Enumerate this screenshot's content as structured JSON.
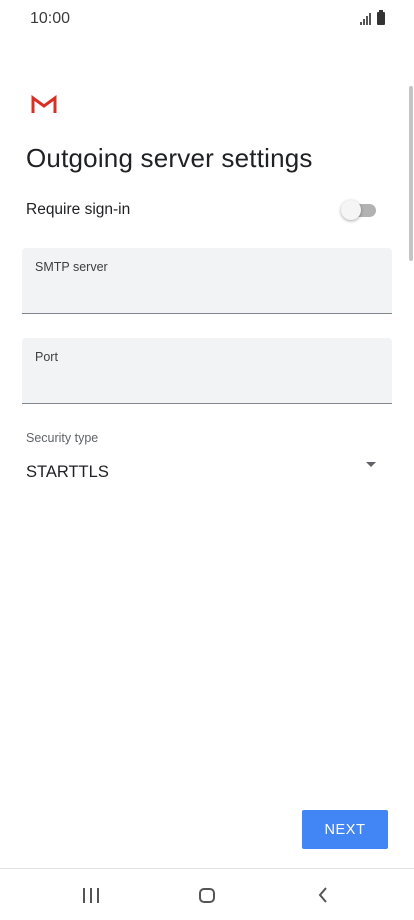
{
  "status_bar": {
    "time": "10:00",
    "icons": [
      "signal-icon",
      "battery-icon"
    ]
  },
  "app": {
    "logo": "gmail-logo-icon",
    "title": "Outgoing server settings"
  },
  "require_signin": {
    "label": "Require sign-in",
    "enabled": false
  },
  "fields": {
    "smtp_server": {
      "label": "SMTP server",
      "value": ""
    },
    "port": {
      "label": "Port",
      "value": ""
    }
  },
  "security": {
    "label": "Security type",
    "value": "STARTTLS",
    "icon": "dropdown-arrow-icon"
  },
  "actions": {
    "next_label": "NEXT"
  },
  "nav": {
    "icons": [
      "recents-icon",
      "home-icon",
      "back-icon"
    ]
  },
  "colors": {
    "accent": "#4285f4",
    "gmail_red": "#d93025",
    "field_bg": "#f1f3f4"
  }
}
